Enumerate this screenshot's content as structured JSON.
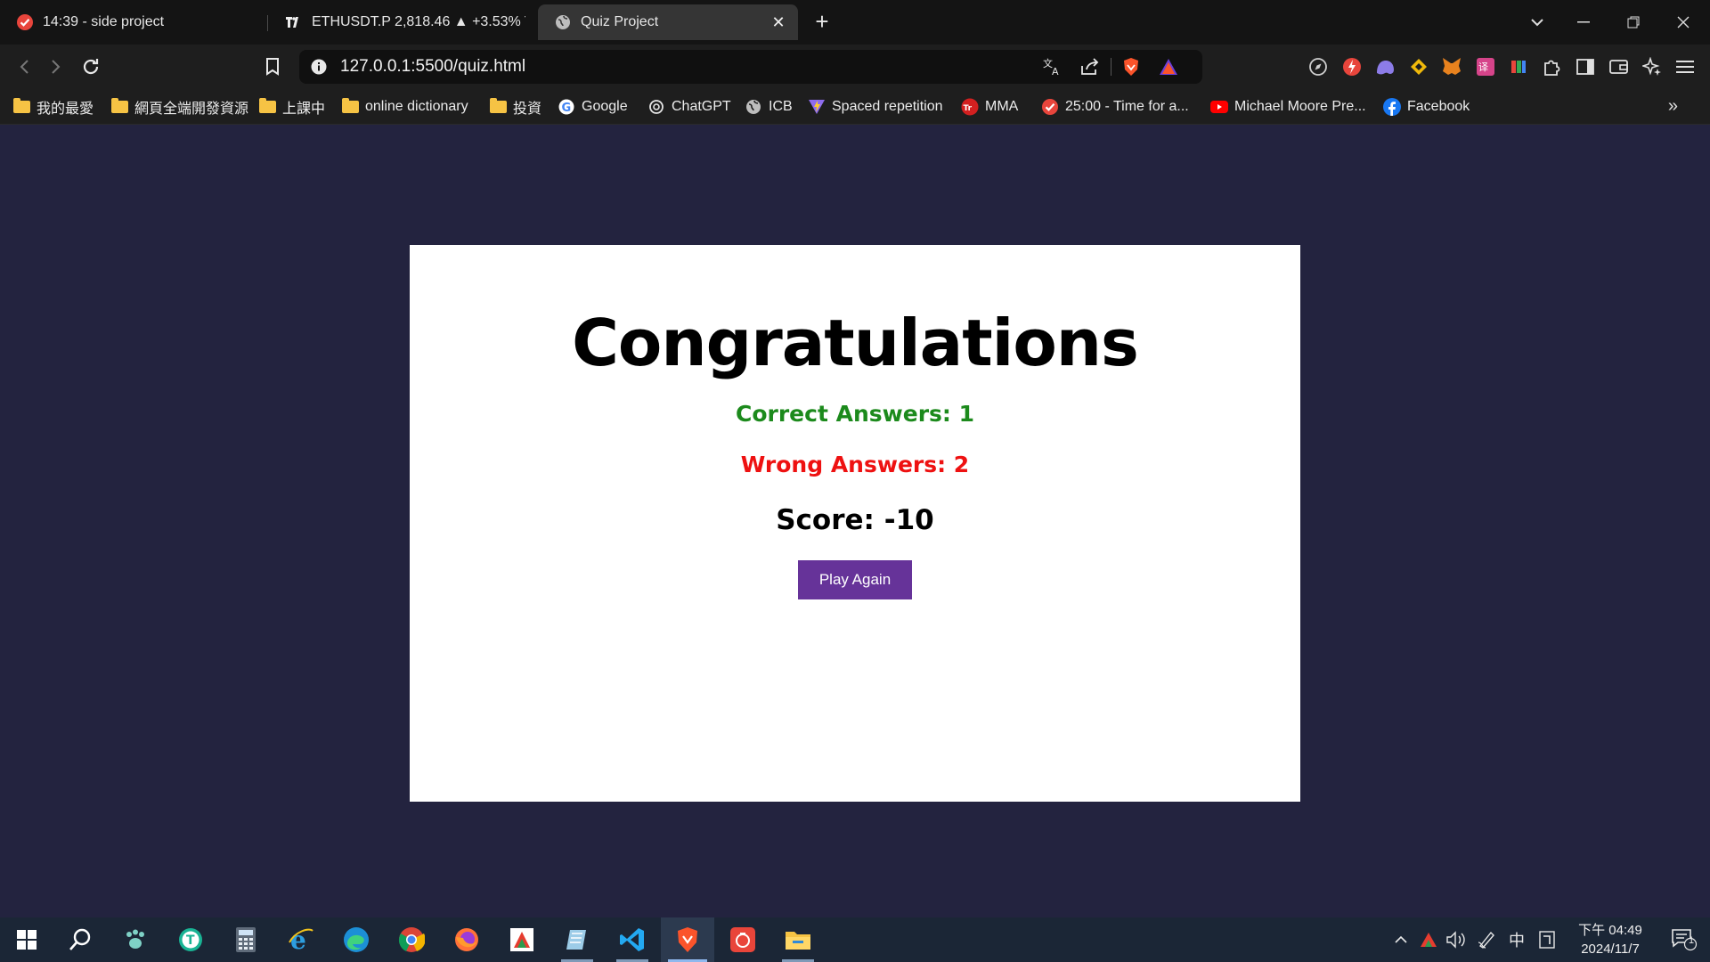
{
  "browser": {
    "tabs": [
      {
        "title": "14:39 - side project",
        "icon": "check-circle-icon"
      },
      {
        "title": "ETHUSDT.P 2,818.46 ▲ +3.53% TV",
        "icon": "tradingview-icon"
      },
      {
        "title": "Quiz Project",
        "icon": "globe-icon",
        "active": true
      }
    ],
    "address": "127.0.0.1:5500/quiz.html",
    "bookmarks": [
      {
        "label": "我的最愛",
        "icon": "folder-icon"
      },
      {
        "label": "網頁全端開發資源",
        "icon": "folder-icon"
      },
      {
        "label": "上課中",
        "icon": "folder-icon"
      },
      {
        "label": "online dictionary",
        "icon": "folder-icon"
      },
      {
        "label": "投資",
        "icon": "folder-icon"
      },
      {
        "label": "Google",
        "icon": "google-icon"
      },
      {
        "label": "ChatGPT",
        "icon": "chatgpt-icon"
      },
      {
        "label": "ICB",
        "icon": "globe-icon"
      },
      {
        "label": "Spaced repetition",
        "icon": "vite-icon"
      },
      {
        "label": "MMA",
        "icon": "mma-icon"
      },
      {
        "label": "25:00 - Time for a...",
        "icon": "check-circle-icon"
      },
      {
        "label": "Michael Moore Pre...",
        "icon": "youtube-icon"
      },
      {
        "label": "Facebook",
        "icon": "facebook-icon"
      }
    ]
  },
  "quiz": {
    "title": "Congratulations",
    "correct_label": "Correct Answers: 1",
    "correct_count": 1,
    "wrong_label": "Wrong Answers: 2",
    "wrong_count": 2,
    "score_label": "Score: -10",
    "score": -10,
    "play_again": "Play Again"
  },
  "taskbar": {
    "ime": "中",
    "time": "下午 04:49",
    "date": "2024/11/7",
    "notification_count": "1"
  },
  "colors": {
    "page_bg": "#23233f",
    "correct": "#1c8a1c",
    "wrong": "#ee1111",
    "button": "#663399"
  }
}
